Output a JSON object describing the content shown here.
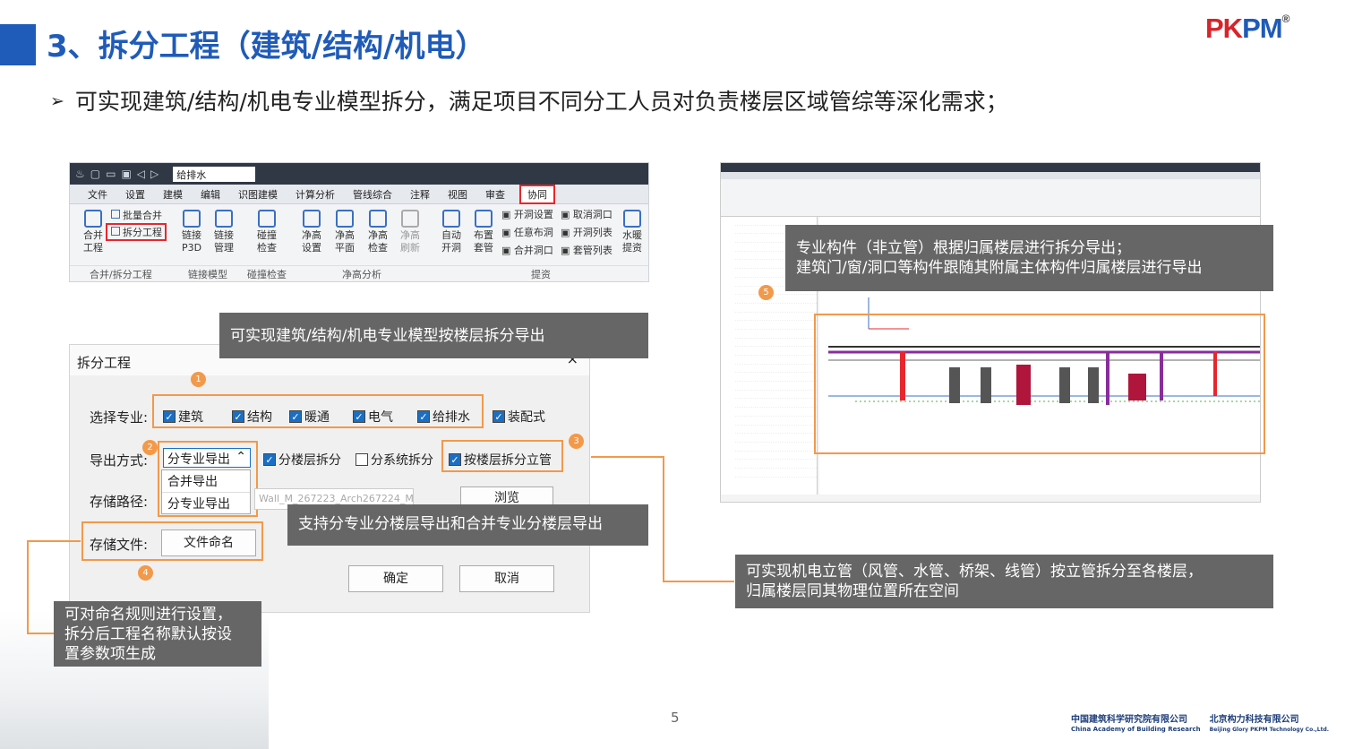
{
  "title": "3、拆分工程（建筑/结构/机电）",
  "logo": {
    "pk": "PK",
    "pm": "PM",
    "reg": "®"
  },
  "bullet": "可实现建筑/结构/机电专业模型拆分，满足项目不同分工人员对负责楼层区域管综等深化需求；",
  "toolbar": {
    "dropdown": "给排水",
    "menu": [
      "文件",
      "设置",
      "建模",
      "编辑",
      "识图建模",
      "计算分析",
      "管线综合",
      "注释",
      "视图",
      "审查"
    ],
    "menu_active": "协同",
    "buttons": {
      "merge": "合并\n工程",
      "batch_merge": "批量合并",
      "split": "拆分工程",
      "link_p3d": "链接\nP3D",
      "link_mgr": "链接\n管理",
      "collide": "碰撞\n检查",
      "h_set": "净高\n设置",
      "h_plane": "净高\n平面",
      "h_check": "净高\n检查",
      "h_refresh": "净高\n刷新",
      "auto_hole": "自动\n开洞",
      "sleeve": "布置\n套管",
      "hole_set": "开洞设置",
      "any_hole": "任意布洞",
      "merge_hole": "合并洞口",
      "cancel_hole": "取消洞口",
      "hole_list": "开洞列表",
      "sleeve_list": "套管列表",
      "heat": "水暖\n提资"
    },
    "groups": [
      "合并/拆分工程",
      "链接模型",
      "碰撞检查",
      "净高分析",
      "提资"
    ]
  },
  "dialog": {
    "title": "拆分工程",
    "close": "×",
    "label_spec": "选择专业:",
    "specs": [
      {
        "label": "建筑",
        "checked": true
      },
      {
        "label": "结构",
        "checked": true
      },
      {
        "label": "暖通",
        "checked": true
      },
      {
        "label": "电气",
        "checked": true
      },
      {
        "label": "给排水",
        "checked": true
      },
      {
        "label": "装配式",
        "checked": true
      }
    ],
    "label_export": "导出方式:",
    "export_value": "分专业导出",
    "export_options": [
      "合并导出",
      "分专业导出"
    ],
    "opt_floor": {
      "label": "分楼层拆分",
      "checked": true
    },
    "opt_system": {
      "label": "分系统拆分",
      "checked": false
    },
    "opt_riser": {
      "label": "按楼层拆分立管",
      "checked": true
    },
    "label_path": "存储路径:",
    "path_value": "Wall_M_267223_Arch267224_M",
    "browse": "浏览",
    "label_file": "存储文件:",
    "file_btn": "文件命名",
    "ok": "确定",
    "cancel": "取消",
    "badges": [
      "1",
      "2",
      "3",
      "4"
    ]
  },
  "callouts": {
    "c1": "可实现建筑/结构/机电专业模型按楼层拆分导出",
    "c2": "支持分专业分楼层导出和合并专业分楼层导出",
    "c3": "可对命名规则进行设置，\n拆分后工程名称默认按设\n置参数项生成",
    "c4": "专业构件（非立管）根据归属楼层进行拆分导出；\n建筑门/窗/洞口等构件跟随其附属主体构件归属楼层进行导出",
    "c5": "可实现机电立管（风管、水管、桥架、线管）按立管拆分至各楼层，\n归属楼层同其物理位置所在空间",
    "badge5": "5"
  },
  "page_number": "5",
  "footer": {
    "cabr_cn": "中国建筑科学研究院有限公司",
    "cabr_en": "China Academy of Building Research",
    "pkpm_cn": "北京构力科技有限公司",
    "pkpm_en": "Beijing Glory PKPM Technology Co.,Ltd."
  },
  "colors": {
    "accent": "#1f5bb8",
    "highlight": "#f2994a",
    "red": "#e8262d",
    "callout_bg": "#666666"
  }
}
